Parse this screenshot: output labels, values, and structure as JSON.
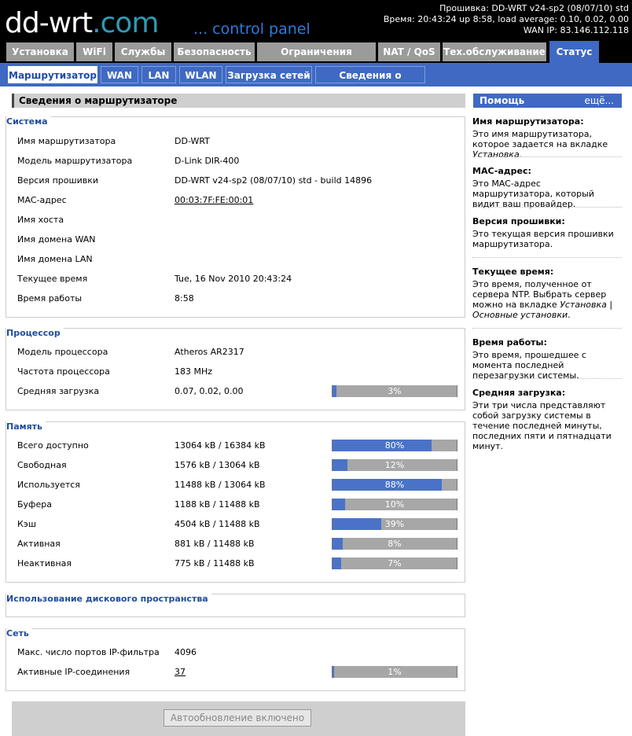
{
  "header": {
    "logo_main": "dd-wrt",
    "logo_dotcom": ".com",
    "logo_cp": "... control panel",
    "firmware_line": "Прошивка: DD-WRT v24-sp2 (08/07/10) std",
    "time_line": "Время: 20:43:24 up 8:58, load average: 0.10, 0.02, 0.00",
    "wan_line": "WAN IP: 83.146.112.118"
  },
  "tabs": [
    {
      "label": "Установка"
    },
    {
      "label": "WiFi"
    },
    {
      "label": "Службы"
    },
    {
      "label": "Безопасность"
    },
    {
      "label": "Ограничения доступа"
    },
    {
      "label": "NAT / QoS"
    },
    {
      "label": "Тех.обслуживание"
    },
    {
      "label": "Статус"
    }
  ],
  "subtabs": [
    {
      "label": "Маршрутизатор"
    },
    {
      "label": "WAN"
    },
    {
      "label": "LAN"
    },
    {
      "label": "WLAN"
    },
    {
      "label": "Загрузка сетей"
    },
    {
      "label": "Сведения о системе"
    }
  ],
  "content_title": "Сведения о маршрутизаторе",
  "system": {
    "title": "Система",
    "rows": [
      {
        "label": "Имя маршрутизатора",
        "value": "DD-WRT"
      },
      {
        "label": "Модель маршрутизатора",
        "value": "D-Link DIR-400"
      },
      {
        "label": "Версия прошивки",
        "value": "DD-WRT v24-sp2 (08/07/10) std - build 14896"
      },
      {
        "label": "MAC-адрес",
        "value": "00:03:7F:FE:00:01"
      },
      {
        "label": "Имя хоста",
        "value": ""
      },
      {
        "label": "Имя домена WAN",
        "value": ""
      },
      {
        "label": "Имя домена LAN",
        "value": ""
      },
      {
        "label": "Текущее время",
        "value": "Tue, 16 Nov 2010 20:43:24"
      },
      {
        "label": "Время работы",
        "value": "8:58"
      }
    ]
  },
  "cpu": {
    "title": "Процессор",
    "rows": [
      {
        "label": "Модель процессора",
        "value": "Atheros AR2317"
      },
      {
        "label": "Частота процессора",
        "value": "183 MHz"
      },
      {
        "label": "Средняя загрузка",
        "value": "0.07, 0.02, 0.00",
        "bar_percent": 3,
        "bar_text": "3%"
      }
    ]
  },
  "memory": {
    "title": "Память",
    "rows": [
      {
        "label": "Всего доступно",
        "value": "13064 kB / 16384 kB",
        "bar_percent": 80,
        "bar_text": "80%"
      },
      {
        "label": "Свободная",
        "value": "1576 kB / 13064 kB",
        "bar_percent": 12,
        "bar_text": "12%"
      },
      {
        "label": "Используется",
        "value": "11488 kB / 13064 kB",
        "bar_percent": 88,
        "bar_text": "88%"
      },
      {
        "label": "Буфера",
        "value": "1188 kB / 11488 kB",
        "bar_percent": 10,
        "bar_text": "10%"
      },
      {
        "label": "Кэш",
        "value": "4504 kB / 11488 kB",
        "bar_percent": 39,
        "bar_text": "39%"
      },
      {
        "label": "Активная",
        "value": "881 kB / 11488 kB",
        "bar_percent": 8,
        "bar_text": "8%"
      },
      {
        "label": "Неактивная",
        "value": "775 kB / 11488 kB",
        "bar_percent": 7,
        "bar_text": "7%"
      }
    ]
  },
  "disk": {
    "title": "Использование дискового пространства"
  },
  "network": {
    "title": "Сеть",
    "rows": [
      {
        "label": "Макс. число портов IP-фильтра",
        "value": "4096"
      },
      {
        "label": "Активные IP-соединения",
        "value": "37",
        "bar_percent": 1,
        "bar_text": "1%"
      }
    ]
  },
  "autorefresh_label": "Автообновление включено",
  "help": {
    "title": "Помощь",
    "more": "ещё...",
    "items": [
      {
        "h": "Имя маршрутизатора:",
        "d": "Это имя маршрутизатора, которое задается на вкладке ",
        "di": "Установка",
        "d2": "."
      },
      {
        "h": "MAC-адрес:",
        "d": "Это MAC-адрес маршрутизатора, который видит ваш провайдер.",
        "di": "",
        "d2": ""
      },
      {
        "h": "Версия прошивки:",
        "d": "Это текущая версия прошивки маршрутизатора.",
        "di": "",
        "d2": ""
      },
      {
        "h": "Текущее время:",
        "d": "Это время, полученное от сервера NTP. Выбрать сервер можно на вкладке ",
        "di": "Установка | Основные установки",
        "d2": "."
      },
      {
        "h": "Время работы:",
        "d": "Это время, прошедшее с момента последней перезагрузки системы.",
        "di": "",
        "d2": ""
      },
      {
        "h": "Средняя загрузка:",
        "d": "Эти три числа представляют собой загрузку системы в течение последней минуты, последних пяти и пятнадцати минут.",
        "di": "",
        "d2": ""
      }
    ]
  },
  "colors": {
    "accent": "#3f69c2",
    "section_title": "#1f4c9c",
    "bar_fill": "#4a73c8",
    "bar_bg": "#a7a7a7"
  }
}
